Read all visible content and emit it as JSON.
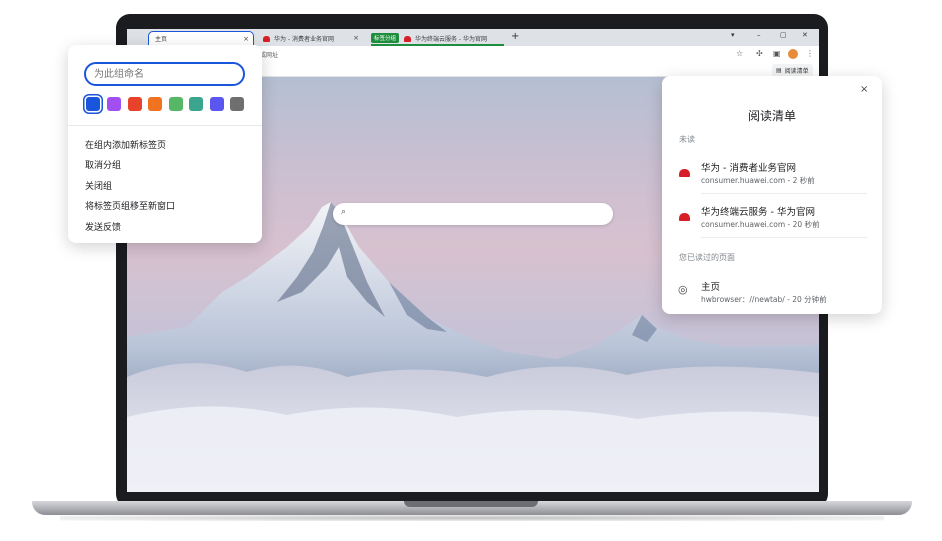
{
  "tabs": [
    {
      "label": "主页",
      "close": "×"
    },
    {
      "label": "华为 - 消费者业务官网",
      "close": "×"
    },
    {
      "label": "华为终端云服务 - 华为官网",
      "close": "×"
    }
  ],
  "tab_group_chip": "标签分组",
  "new_tab_symbol": "+",
  "window_controls": {
    "tablist": "▾",
    "minimize": "–",
    "restore": "▢",
    "close": "✕"
  },
  "omnibox_text": "或网址",
  "toolbar_icons": {
    "star": "☆",
    "extensions": "✣",
    "menu": "⋮"
  },
  "reading_list_button": "阅读清单",
  "group_popup": {
    "name_placeholder": "为此组命名",
    "colors": [
      "#1a56db",
      "#a14ff0",
      "#e8412c",
      "#f07320",
      "#56b866",
      "#3ba58f",
      "#5a57f0",
      "#6f6f6f"
    ],
    "selected_color_index": 0,
    "menu": [
      "在组内添加新标签页",
      "取消分组",
      "关闭组",
      "将标签页组移至新窗口",
      "发送反馈"
    ]
  },
  "reading_list": {
    "title": "阅读清单",
    "close": "×",
    "unread_label": "未读",
    "read_label": "您已读过的页面",
    "unread": [
      {
        "title": "华为 - 消费者业务官网",
        "meta": "consumer.huawei.com - 2 秒前"
      },
      {
        "title": "华为终端云服务 - 华为官网",
        "meta": "consumer.huawei.com - 20 秒前"
      }
    ],
    "read": [
      {
        "title": "主页",
        "meta": "hwbrowser：//newtab/ - 20 分钟前"
      }
    ]
  },
  "ntp_search_icon": "⌕",
  "globe_icon": "◎"
}
